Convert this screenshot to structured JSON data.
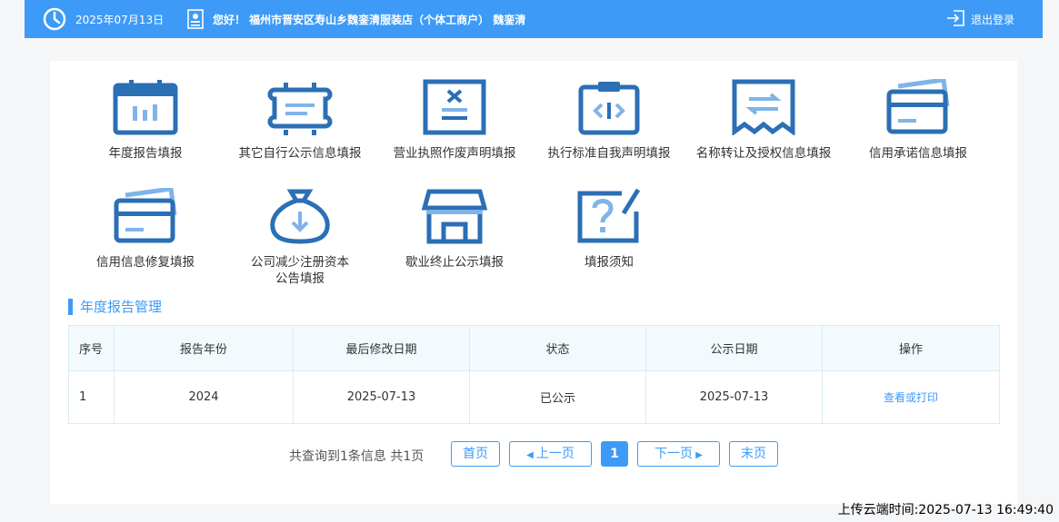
{
  "header": {
    "date": "2025年07月13日",
    "greeting": "您好！ 福州市晋安区寿山乡魏銮清服装店（个体工商户） 魏銮清",
    "logout_label": "退出登录"
  },
  "tiles": [
    {
      "label": "年度报告填报"
    },
    {
      "label": "其它自行公示信息填报"
    },
    {
      "label": "营业执照作废声明填报"
    },
    {
      "label": "执行标准自我声明填报"
    },
    {
      "label": "名称转让及授权信息填报"
    },
    {
      "label": "信用承诺信息填报"
    },
    {
      "label": "信用信息修复填报"
    },
    {
      "label": "公司减少注册资本",
      "label2": "公告填报"
    },
    {
      "label": "歇业终止公示填报"
    },
    {
      "label": "填报须知"
    }
  ],
  "section": {
    "title": "年度报告管理"
  },
  "table": {
    "headers": [
      "序号",
      "报告年份",
      "最后修改日期",
      "状态",
      "公示日期",
      "操作"
    ],
    "rows": [
      {
        "idx": "1",
        "year": "2024",
        "modified": "2025-07-13",
        "status": "已公示",
        "published": "2025-07-13",
        "action": "查看或打印"
      }
    ]
  },
  "pager": {
    "info": "共查询到1条信息 共1页",
    "first": "首页",
    "prev": "上一页",
    "current": "1",
    "next": "下一页",
    "last": "末页"
  },
  "footer": {
    "upload_time": "上传云端时间:2025-07-13 16:49:40"
  },
  "colors": {
    "accent": "#3d9bf7",
    "icon_blue": "#2b6fb5",
    "icon_light": "#7fb4e8"
  }
}
